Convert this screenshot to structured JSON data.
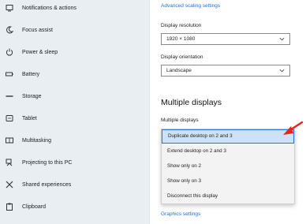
{
  "sidebar": {
    "items": [
      {
        "label": "Notifications & actions",
        "icon": "notifications-icon"
      },
      {
        "label": "Focus assist",
        "icon": "focus-assist-icon"
      },
      {
        "label": "Power & sleep",
        "icon": "power-icon"
      },
      {
        "label": "Battery",
        "icon": "battery-icon"
      },
      {
        "label": "Storage",
        "icon": "storage-icon"
      },
      {
        "label": "Tablet",
        "icon": "tablet-icon"
      },
      {
        "label": "Multitasking",
        "icon": "multitasking-icon"
      },
      {
        "label": "Projecting to this PC",
        "icon": "projecting-icon"
      },
      {
        "label": "Shared experiences",
        "icon": "shared-experiences-icon"
      },
      {
        "label": "Clipboard",
        "icon": "clipboard-icon"
      }
    ]
  },
  "main": {
    "advanced_scaling_link": "Advanced scaling settings",
    "resolution_label": "Display resolution",
    "resolution_value": "1920 × 1080",
    "orientation_label": "Display orientation",
    "orientation_value": "Landscape",
    "multiple_displays_heading": "Multiple displays",
    "multiple_displays_label": "Multiple displays",
    "dropdown_options": [
      "Duplicate desktop on 2 and 3",
      "Extend desktop on 2 and 3",
      "Show only on 2",
      "Show only on 3",
      "Disconnect this display"
    ],
    "selected_option": "Duplicate desktop on 2 and 3",
    "graphics_link": "Graphics settings"
  },
  "colors": {
    "sidebar_bg": "#e9eef3",
    "link": "#1e6fd1",
    "selection_bg": "#cce3f5",
    "selection_border": "#1f7ad9",
    "annotation_arrow": "#e8241c"
  }
}
